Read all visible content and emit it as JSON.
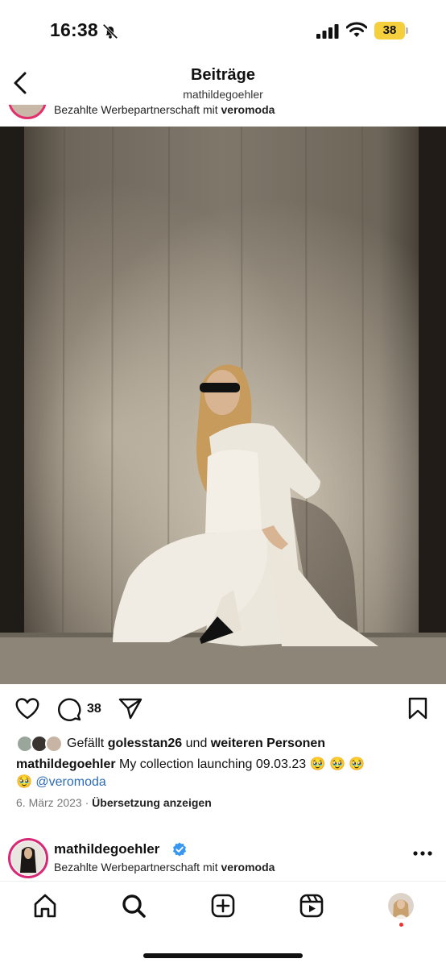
{
  "status_bar": {
    "time": "16:38",
    "battery": "38"
  },
  "header": {
    "title": "Beiträge",
    "subtitle": "mathildegoehler"
  },
  "previous_post": {
    "sponsor_prefix": "Bezahlte Werbepartnerschaft mit",
    "sponsor_brand": "veromoda"
  },
  "post": {
    "comment_count": "38",
    "likes_prefix": "Gefällt",
    "likes_user": "golesstan26",
    "likes_middle": "und",
    "likes_suffix": "weiteren Personen",
    "caption_user": "mathildegoehler",
    "caption_text": "My collection launching 09.03.23 🥹 🥹 🥹",
    "caption_line2_emoji": "🥹",
    "caption_mention": "@veromoda",
    "date": "6. März 2023",
    "separator": "·",
    "translate": "Übersetzung anzeigen"
  },
  "next_post": {
    "username": "mathildegoehler",
    "sponsor_prefix": "Bezahlte Werbepartnerschaft mit",
    "sponsor_brand": "veromoda"
  },
  "colors": {
    "accent_link": "#2d6bb5",
    "story_ring": "#d62976",
    "battery": "#f5cf3c",
    "verified": "#3897f0"
  },
  "icons": [
    "bell-slash-icon",
    "signal-icon",
    "wifi-icon",
    "battery-icon",
    "back-chevron-icon",
    "heart-icon",
    "comment-icon",
    "share-icon",
    "bookmark-icon",
    "verified-icon",
    "more-icon",
    "home-icon",
    "search-icon",
    "create-icon",
    "reels-icon"
  ]
}
